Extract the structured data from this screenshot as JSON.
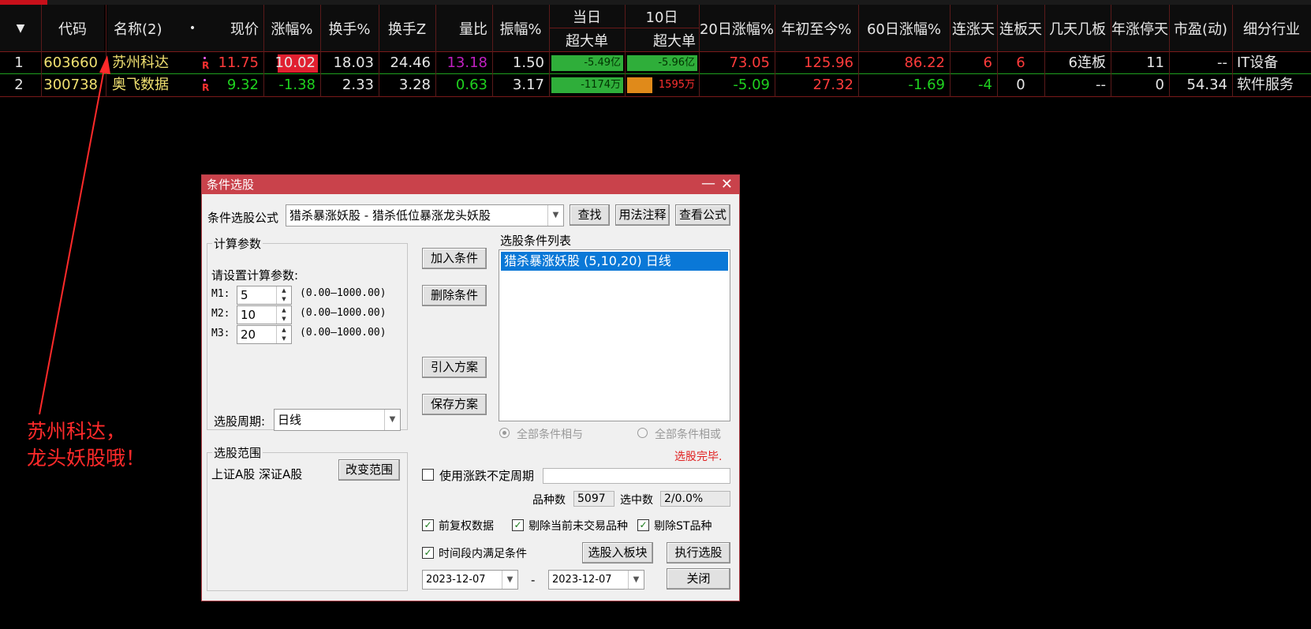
{
  "table": {
    "headers": {
      "code": "代码",
      "name": "名称(2)",
      "dot": "•",
      "price": "现价",
      "change_pct": "涨幅%",
      "turnover": "换手%",
      "turnover_z": "换手Z",
      "volume_ratio": "量比",
      "amplitude": "振幅%",
      "today": "当日",
      "today_sub": "超大单",
      "ten_day": "10日",
      "ten_day_sub": "超大单",
      "change_20d": "20日涨幅%",
      "ytd": "年初至今%",
      "change_60d": "60日涨幅%",
      "up_days": "连涨天",
      "limit_days": "连板天",
      "board_pattern": "几天几板",
      "limit_days_year": "年涨停天",
      "pe": "市盈(动)",
      "industry": "细分行业"
    },
    "rows": [
      {
        "index": "1",
        "code": "603660",
        "name": "苏州科达",
        "flag": "R",
        "price": "11.75",
        "change_pct": "10.02",
        "turnover": "18.03",
        "turnover_z": "24.46",
        "volume_ratio": "13.18",
        "amplitude": "1.50",
        "today_big": "-5.49亿",
        "ten_day_big": "-5.96亿",
        "change_20d": "73.05",
        "ytd": "125.96",
        "change_60d": "86.22",
        "up_days": "6",
        "limit_days": "6",
        "board_pattern": "6连板",
        "limit_days_year": "11",
        "pe": "--",
        "industry": "IT设备"
      },
      {
        "index": "2",
        "code": "300738",
        "name": "奥飞数据",
        "flag": "R",
        "price": "9.32",
        "change_pct": "-1.38",
        "turnover": "2.33",
        "turnover_z": "3.28",
        "volume_ratio": "0.63",
        "amplitude": "3.17",
        "today_big": "-1174万",
        "ten_day_big": "1595万",
        "change_20d": "-5.09",
        "ytd": "27.32",
        "change_60d": "-1.69",
        "up_days": "-4",
        "limit_days": "0",
        "board_pattern": "--",
        "limit_days_year": "0",
        "pe": "54.34",
        "industry": "软件服务"
      }
    ]
  },
  "annotation": {
    "line1": "苏州科达，",
    "line2": "龙头妖股哦！",
    "color": "#ff2a2a"
  },
  "dialog": {
    "title": "条件选股",
    "minimize": "—",
    "close": "✕",
    "formula_label": "条件选股公式",
    "formula_value": "猎杀暴涨妖股 - 猎杀低位暴涨龙头妖股",
    "find_button": "查找",
    "usage_button": "用法注释",
    "view_button": "查看公式",
    "calc_group": "计算参数",
    "calc_prompt": "请设置计算参数:",
    "params": [
      {
        "label": "M1:",
        "value": "5",
        "range": "(0.00—1000.00)"
      },
      {
        "label": "M2:",
        "value": "10",
        "range": "(0.00—1000.00)"
      },
      {
        "label": "M3:",
        "value": "20",
        "range": "(0.00—1000.00)"
      }
    ],
    "period_label": "选股周期:",
    "period_value": "日线",
    "add_button": "加入条件",
    "delete_button": "删除条件",
    "import_button": "引入方案",
    "save_button": "保存方案",
    "list_title": "选股条件列表",
    "list_items": [
      "猎杀暴涨妖股 (5,10,20) 日线"
    ],
    "radio_and": "全部条件相与",
    "radio_or": "全部条件相或",
    "status": "选股完毕.",
    "scope_group": "选股范围",
    "scope_value": "上证A股 深证A股",
    "change_scope_button": "改变范围",
    "use_period_label": "使用涨跌不定周期",
    "count_label": "品种数",
    "count_value": "5097",
    "selected_label": "选中数",
    "selected_value": "2/0.0%",
    "opt_adjust": "前复权数据",
    "opt_exclude_untraded": "剔除当前未交易品种",
    "opt_exclude_st": "剔除ST品种",
    "opt_time_range": "时间段内满足条件",
    "to_block_button": "选股入板块",
    "execute_button": "执行选股",
    "date_from": "2023-12-07",
    "date_sep": "-",
    "date_to": "2023-12-07",
    "close_button": "关闭"
  }
}
